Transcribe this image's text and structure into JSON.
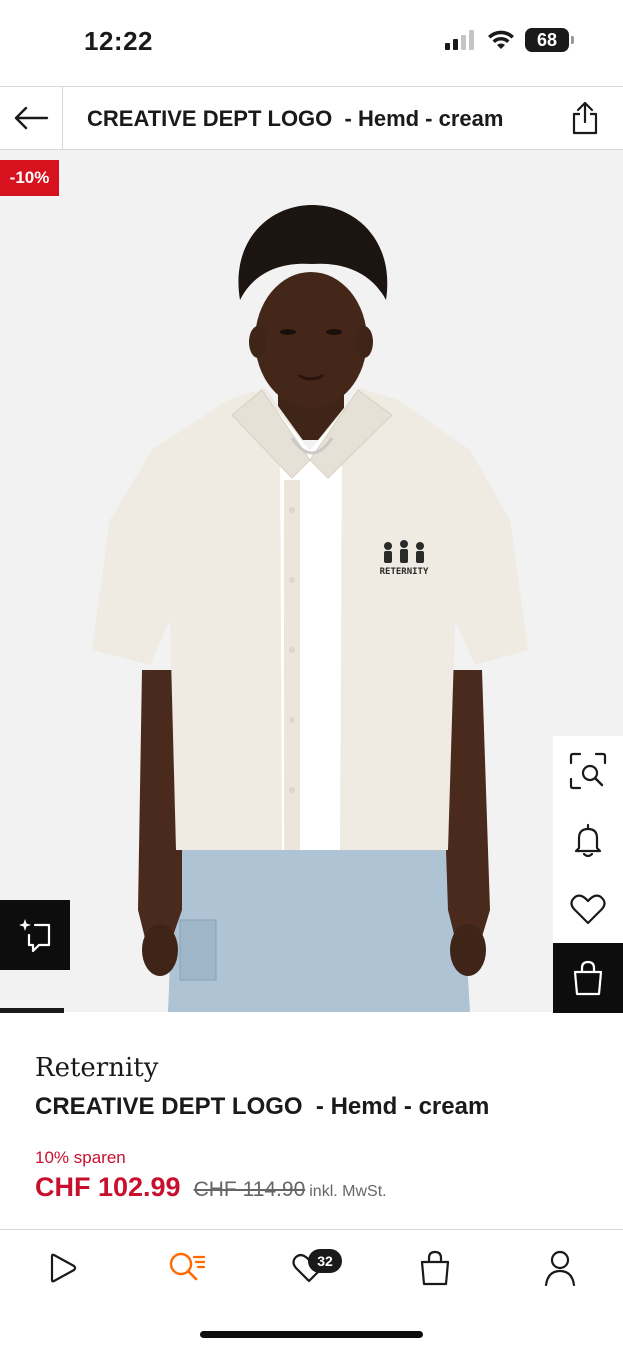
{
  "status_bar": {
    "time": "12:22",
    "battery": "68"
  },
  "header": {
    "title": "CREATIVE DEPT LOGO  - Hemd - cream"
  },
  "image": {
    "discount_badge": "-10%",
    "shirt_logo_text": "RETERNITY"
  },
  "product": {
    "brand": "Reternity",
    "name": "CREATIVE DEPT LOGO  - Hemd - cream",
    "save_text": "10% sparen",
    "price": "CHF 102.99",
    "old_price": "CHF 114.90",
    "tax_note": "inkl. MwSt."
  },
  "bottom_nav": {
    "wishlist_count": "32"
  },
  "icons": {
    "back": "arrow-left-icon",
    "share": "share-icon",
    "visual_search": "visual-search-icon",
    "notify": "bell-icon",
    "wishlist": "heart-icon",
    "cart": "shopping-bag-icon",
    "ai": "sparkle-chat-icon",
    "nav": [
      "play-icon",
      "search-icon",
      "heart-icon",
      "bag-icon",
      "person-icon"
    ]
  },
  "colors": {
    "accent": "#c8102e",
    "search_accent": "#ff6900",
    "dark": "#0d0d0d"
  }
}
